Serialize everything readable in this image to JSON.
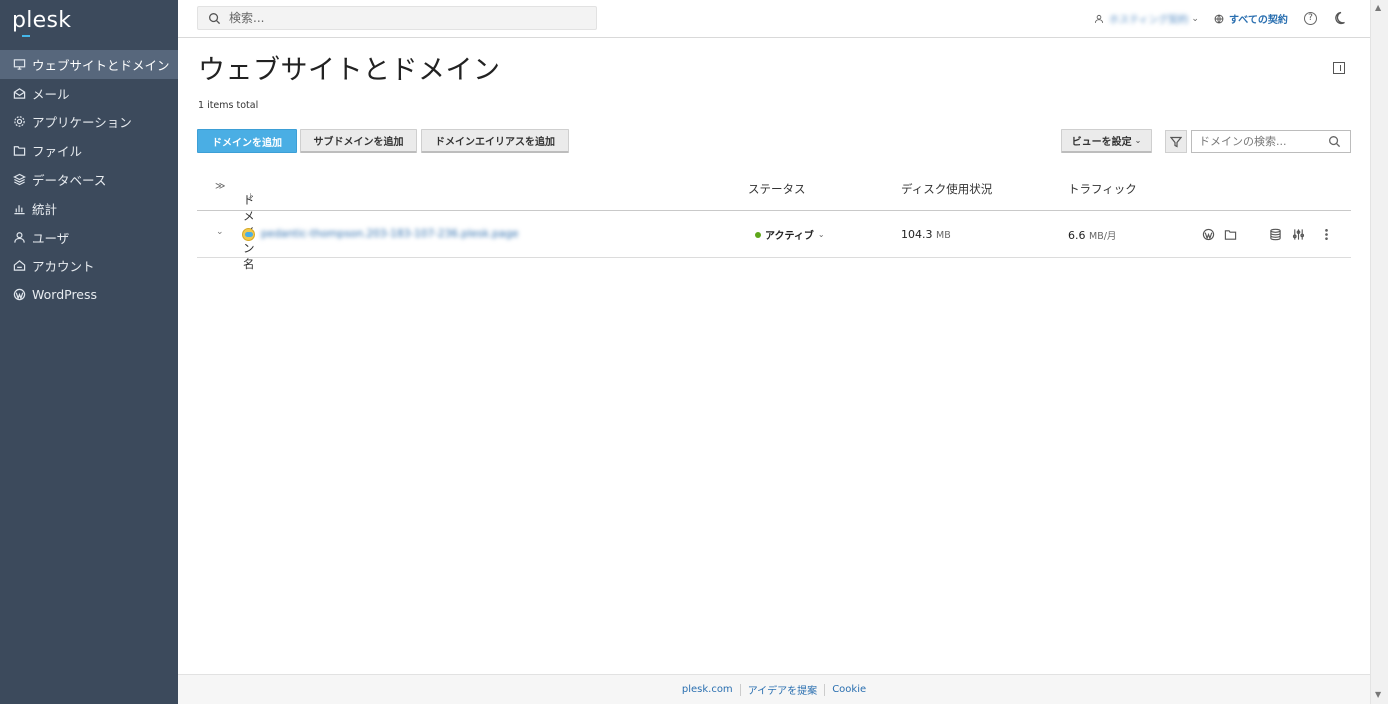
{
  "app": {
    "logo": "plesk"
  },
  "sidebar": {
    "items": [
      {
        "label": "ウェブサイトとドメイン",
        "icon": "monitor-icon",
        "active": true
      },
      {
        "label": "メール",
        "icon": "mail-icon"
      },
      {
        "label": "アプリケーション",
        "icon": "gear-icon"
      },
      {
        "label": "ファイル",
        "icon": "folder-icon"
      },
      {
        "label": "データベース",
        "icon": "layers-icon"
      },
      {
        "label": "統計",
        "icon": "bar-chart-icon"
      },
      {
        "label": "ユーザ",
        "icon": "user-icon"
      },
      {
        "label": "アカウント",
        "icon": "account-icon"
      },
      {
        "label": "WordPress",
        "icon": "wordpress-icon"
      }
    ]
  },
  "header": {
    "search_placeholder": "検索...",
    "user_label": "ホスティング契約",
    "subscriptions_label": "すべての契約",
    "help_label": "?"
  },
  "main": {
    "title": "ウェブサイトとドメイン",
    "items_total": "1 items total",
    "buttons": {
      "add_domain": "ドメインを追加",
      "add_subdomain": "サブドメインを追加",
      "add_alias": "ドメインエイリアスを追加",
      "set_view": "ビューを設定"
    },
    "domain_search_placeholder": "ドメインの検索...",
    "table": {
      "headers": {
        "name": "ドメイン名",
        "status": "ステータス",
        "disk": "ディスク使用状況",
        "traffic": "トラフィック"
      },
      "rows": [
        {
          "domain": "pedantic-thompson.203-183-107-236.plesk.page",
          "status": "アクティブ",
          "disk_value": "104.3",
          "disk_unit": "MB",
          "traffic_value": "6.6",
          "traffic_unit": "MB/月"
        }
      ]
    }
  },
  "footer": {
    "links": [
      "plesk.com",
      "アイデアを提案",
      "Cookie"
    ]
  },
  "colors": {
    "sidebar_bg": "#3c4a5c",
    "sidebar_active": "#57677c",
    "primary_button": "#4aaee4",
    "status_active": "#5ea71a",
    "link": "#2a6fb0"
  }
}
